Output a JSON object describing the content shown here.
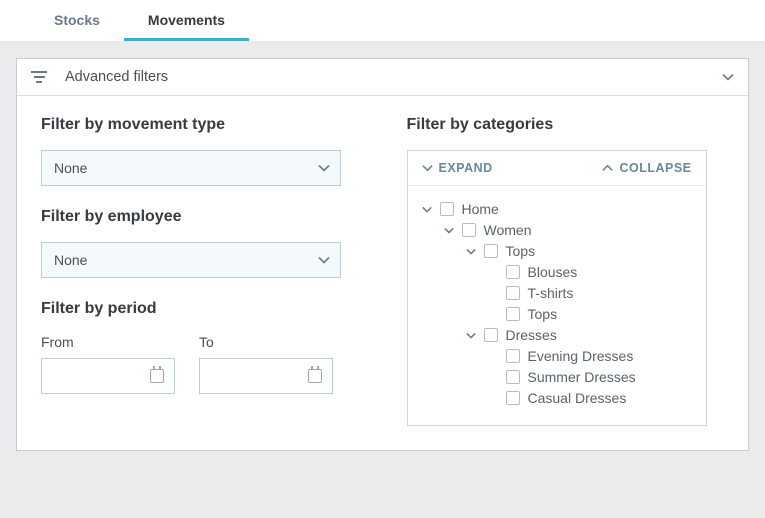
{
  "tabs": {
    "stocks": "Stocks",
    "movements": "Movements"
  },
  "panel": {
    "title": "Advanced filters"
  },
  "filters": {
    "movement_type": {
      "heading": "Filter by movement type",
      "value": "None"
    },
    "employee": {
      "heading": "Filter by employee",
      "value": "None"
    },
    "period": {
      "heading": "Filter by period",
      "from_label": "From",
      "to_label": "To"
    }
  },
  "categories": {
    "heading": "Filter by categories",
    "expand_label": "EXPAND",
    "collapse_label": "COLLAPSE",
    "tree": {
      "home": "Home",
      "women": "Women",
      "tops": "Tops",
      "blouses": "Blouses",
      "tshirts": "T-shirts",
      "tops_leaf": "Tops",
      "dresses": "Dresses",
      "evening": "Evening Dresses",
      "summer": "Summer Dresses",
      "casual": "Casual Dresses"
    }
  }
}
